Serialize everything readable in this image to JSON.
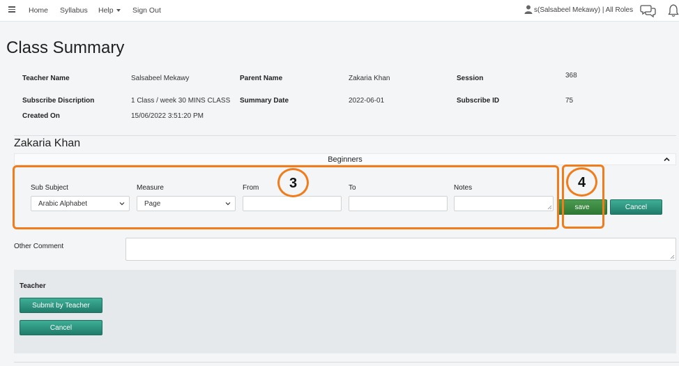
{
  "nav": {
    "home": "Home",
    "syllabus": "Syllabus",
    "help": "Help",
    "sign_out": "Sign Out",
    "user": "s(Salsabeel Mekawy) | All Roles"
  },
  "page_title": "Class Summary",
  "info": {
    "teacher_name_label": "Teacher Name",
    "teacher_name": "Salsabeel Mekawy",
    "parent_name_label": "Parent Name",
    "parent_name": "Zakaria Khan",
    "session_label": "Session",
    "session": "368",
    "subscribe_desc_label": "Subscribe Discription",
    "subscribe_desc": "1 Class / week 30 MINS CLASS",
    "summary_date_label": "Summary Date",
    "summary_date": "2022-06-01",
    "subscribe_id_label": "Subscribe ID",
    "subscribe_id": "75",
    "created_on_label": "Created On",
    "created_on": "15/06/2022 3:51:20 PM"
  },
  "student_name": "Zakaria Khan",
  "panel": {
    "title": "Beginners",
    "sub_subject_label": "Sub Subject",
    "sub_subject_value": "Arabic Alphabet",
    "measure_label": "Measure",
    "measure_value": "Page",
    "from_label": "From",
    "to_label": "To",
    "notes_label": "Notes",
    "save": "save",
    "cancel": "Cancel"
  },
  "annotations": {
    "box3": "3",
    "box4": "4",
    "color": "#f07c1c"
  },
  "other_comment_label": "Other Comment",
  "teacher_section": {
    "label": "Teacher",
    "submit": "Submit by Teacher",
    "cancel": "Cancel"
  },
  "colors": {
    "button_teal": "#2e8f7a",
    "save_green": "#3b8a41",
    "annotation": "#f07c1c"
  }
}
